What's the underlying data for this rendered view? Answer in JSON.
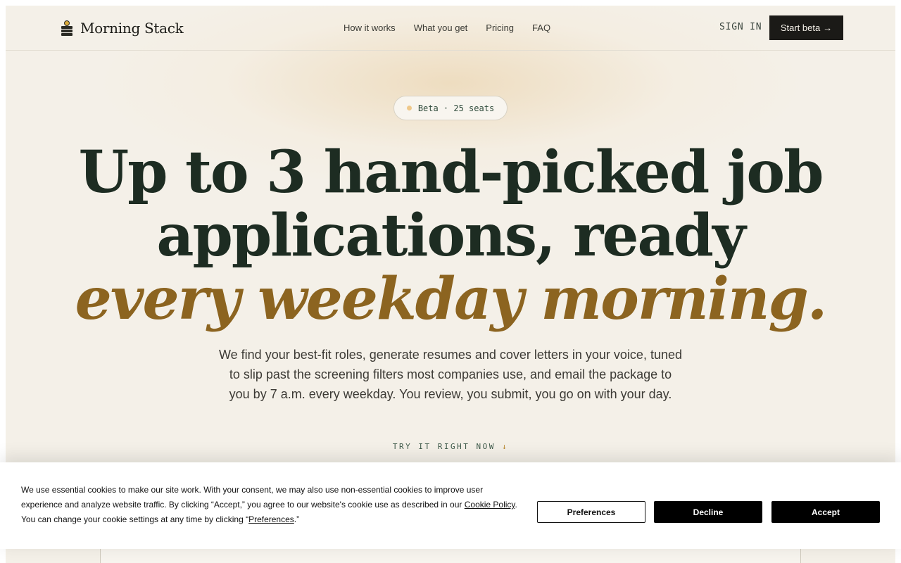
{
  "header": {
    "brand": "Morning Stack",
    "nav": [
      "How it works",
      "What you get",
      "Pricing",
      "FAQ"
    ],
    "sign_in": "SIGN IN",
    "start_beta": "Start beta",
    "start_beta_arrow": "→"
  },
  "hero": {
    "badge": "Beta · 25 seats",
    "headline_line1": "Up to 3 hand-picked job",
    "headline_line2": "applications, ready",
    "headline_accent": "every weekday morning.",
    "subtext": "We find your best-fit roles, generate resumes and cover letters in your voice, tuned to slip past the screening filters most companies use, and email the package to you by 7 a.m. every weekday. You review, you submit, you go on with your day.",
    "cta": "TRY IT RIGHT NOW",
    "cta_arrow": "↓"
  },
  "cookie": {
    "text_part1": "We use essential cookies to make our site work. With your consent, we may also use non-essential cookies to improve user experience and analyze website traffic. By clicking “Accept,” you agree to our website's cookie use as described in our ",
    "cookie_policy_link": "Cookie Policy",
    "text_part2": ". You can change your cookie settings at any time by clicking “",
    "preferences_link": "Preferences",
    "text_part3": ".”",
    "preferences_button": "Preferences",
    "decline_button": "Decline",
    "accept_button": "Accept"
  },
  "colors": {
    "page_bg": "#f4f0e8",
    "accent_gold": "#8c6420",
    "headline": "#1d2c22",
    "button_dark": "#1b1a17"
  }
}
